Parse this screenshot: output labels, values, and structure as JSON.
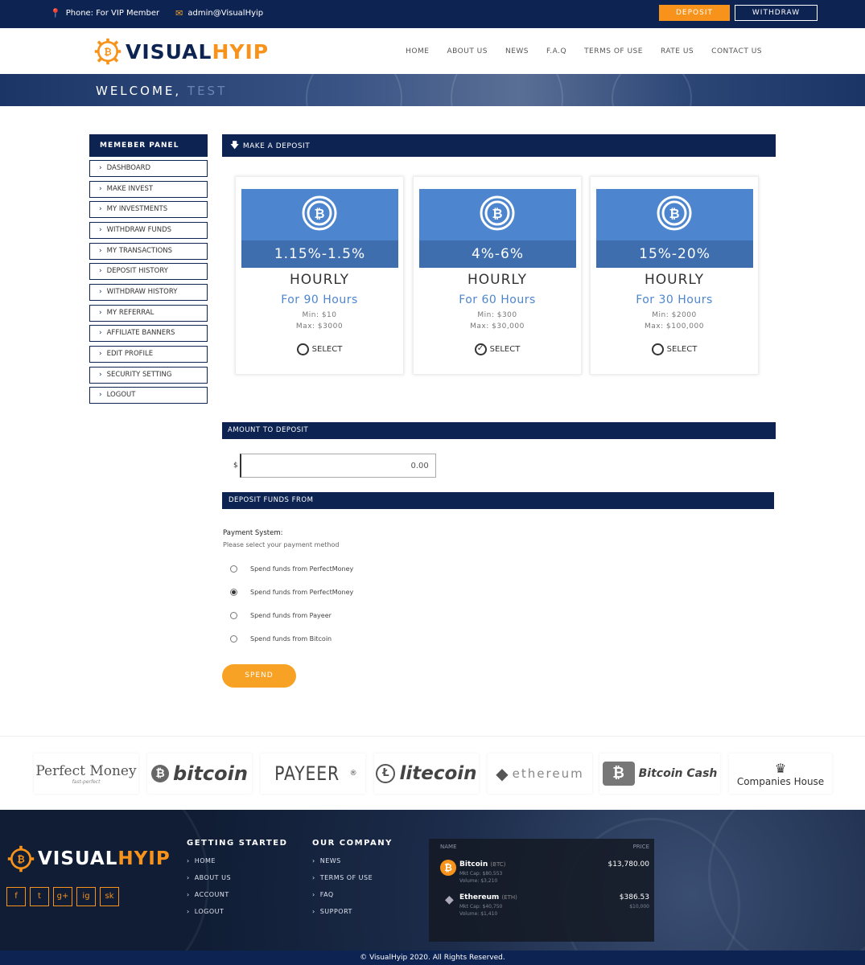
{
  "topbar": {
    "phone": "Phone: For VIP Member",
    "email": "admin@VisualHyip",
    "deposit_label": "DEPOSIT",
    "withdraw_label": "WITHDRAW"
  },
  "header": {
    "logo_part1": "VISUAL",
    "logo_part2": "HYIP",
    "nav": [
      "HOME",
      "ABOUT US",
      "NEWS",
      "F.A.Q",
      "TERMS OF USE",
      "RATE US",
      "CONTACT US"
    ]
  },
  "banner": {
    "welcome": "WELCOME, ",
    "user": "TEST"
  },
  "sidebar": {
    "title": "MEMEBER PANEL",
    "items": [
      "DASHBOARD",
      "MAKE INVEST",
      "MY INVESTMENTS",
      "WITHDRAW FUNDS",
      "MY TRANSACTIONS",
      "DEPOSIT HISTORY",
      "WITHDRAW HISTORY",
      "MY REFERRAL",
      "AFFILIATE BANNERS",
      "EDIT PROFILE",
      "SECURITY SETTING",
      "LOGOUT"
    ]
  },
  "deposit": {
    "title": "MAKE A DEPOSIT",
    "plans": [
      {
        "rate": "1.15%-1.5%",
        "period": "HOURLY",
        "hours": "For 90 Hours",
        "min": "Min: $10",
        "max": "Max: $3000",
        "select": "SELECT",
        "selected": false
      },
      {
        "rate": "4%-6%",
        "period": "HOURLY",
        "hours": "For 60 Hours",
        "min": "Min: $300",
        "max": "Max: $30,000",
        "select": "SELECT",
        "selected": true
      },
      {
        "rate": "15%-20%",
        "period": "HOURLY",
        "hours": "For 30 Hours",
        "min": "Min: $2000",
        "max": "Max: $100,000",
        "select": "SELECT",
        "selected": false
      }
    ]
  },
  "amount": {
    "title": "AMOUNT TO DEPOSIT",
    "currency": "$",
    "value": "0.00"
  },
  "funds": {
    "title": "DEPOSIT FUNDS FROM",
    "payment_title": "Payment System:",
    "payment_sub": "Please select your payment method",
    "options": [
      {
        "label": "Spend funds from PerfectMoney",
        "checked": false
      },
      {
        "label": "Spend funds from PerfectMoney",
        "checked": true
      },
      {
        "label": "Spend funds from Payeer",
        "checked": false
      },
      {
        "label": "Spend funds from Bitcoin",
        "checked": false
      }
    ],
    "spend_label": "SPEND"
  },
  "partners": {
    "perfect_money": "Perfect Money",
    "perfect_money_tag": "fast-perfect",
    "bitcoin": "bitcoin",
    "payeer": "PAYEER",
    "litecoin": "litecoin",
    "ethereum": "ethereum",
    "bitcoin_cash": "Bitcoin Cash",
    "companies_house": "Companies House"
  },
  "footer": {
    "logo_part1": "VISUAL",
    "logo_part2": "HYIP",
    "social": [
      "f",
      "t",
      "g+",
      "ig",
      "sk"
    ],
    "col1_title": "GETTING STARTED",
    "col1_links": [
      "HOME",
      "ABOUT US",
      "ACCOUNT",
      "LOGOUT"
    ],
    "col2_title": "OUR COMPANY",
    "col2_links": [
      "NEWS",
      "TERMS OF USE",
      "FAQ",
      "SUPPORT"
    ],
    "ticker": {
      "col_name": "NAME",
      "col_price": "PRICE",
      "coins": [
        {
          "name": "Bitcoin",
          "symbol": "(BTC)",
          "mktcap": "Mkt Cap: $80,553",
          "volume": "Volume: $3,210",
          "price": "$13,780.00",
          "change": ""
        },
        {
          "name": "Ethereum",
          "symbol": "(ETH)",
          "mktcap": "Mkt Cap: $40,750",
          "volume": "Volume: $1,410",
          "price": "$386.53",
          "change": "$10,000"
        }
      ]
    },
    "copyright": "© VisualHyip 2020. All Rights Reserved."
  },
  "colors": {
    "navy": "#0d2352",
    "orange": "#f7931a",
    "blue": "#4d86cf"
  }
}
